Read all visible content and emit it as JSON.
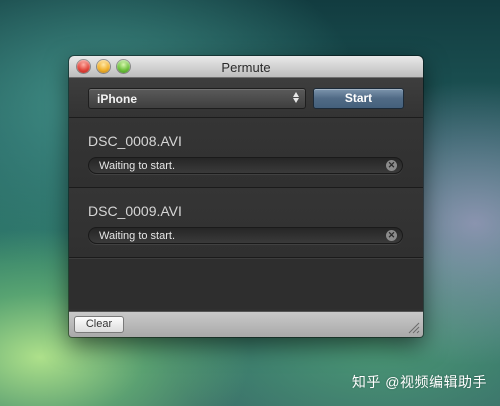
{
  "window": {
    "title": "Permute"
  },
  "toolbar": {
    "format_value": "iPhone",
    "start_label": "Start"
  },
  "files": [
    {
      "name": "DSC_0008.AVI",
      "status": "Waiting to start."
    },
    {
      "name": "DSC_0009.AVI",
      "status": "Waiting to start."
    }
  ],
  "bottom": {
    "clear_label": "Clear"
  },
  "watermark": {
    "text": "知乎 @视频编辑助手"
  },
  "colors": {
    "start_button": "#506a85",
    "window_bg": "#303030",
    "close": "#e0443a",
    "minimize": "#f0b02a",
    "zoom": "#6cc03a"
  }
}
